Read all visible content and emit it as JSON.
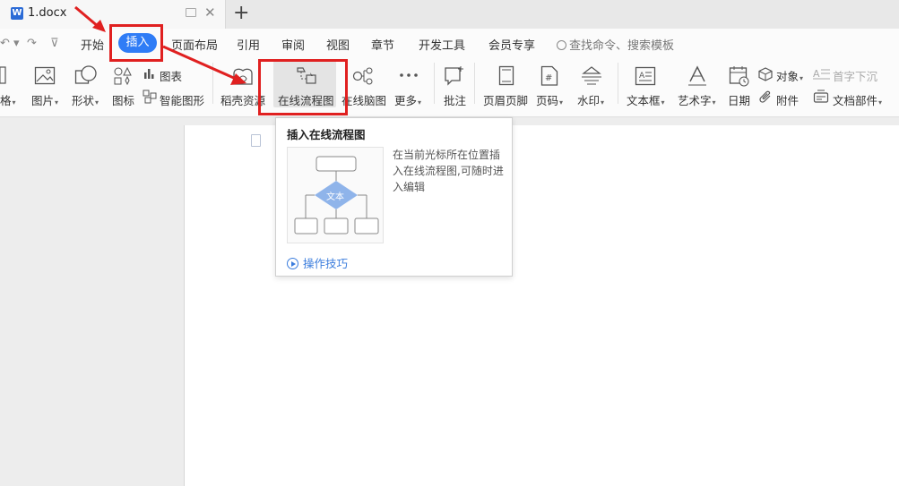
{
  "title_bar": {
    "doc_name": "1.docx",
    "logo_glyph": "W",
    "close_glyph": "✕",
    "new_tab_glyph": "+"
  },
  "menu": {
    "undo_glyph": "↶ ▾",
    "redo_glyph": "↷",
    "more_glyph": "⊽",
    "items": [
      {
        "label": "开始"
      },
      {
        "label": "插入",
        "active": true
      },
      {
        "label": "页面布局"
      },
      {
        "label": "引用"
      },
      {
        "label": "审阅"
      },
      {
        "label": "视图"
      },
      {
        "label": "章节"
      },
      {
        "label": "开发工具"
      },
      {
        "label": "会员专享"
      }
    ],
    "search_text": "查找命令、搜索模板"
  },
  "toolbar": {
    "partial_left": "格",
    "picture": "图片",
    "shape": "形状",
    "icon": "图标",
    "chart": "图表",
    "smart_shape": "智能图形",
    "docer_resources": "稻壳资源",
    "online_flowchart": "在线流程图",
    "online_mindmap": "在线脑图",
    "more": "更多",
    "comment": "批注",
    "header_footer": "页眉页脚",
    "page_number": "页码",
    "watermark": "水印",
    "text_box": "文本框",
    "word_art": "艺术字",
    "date": "日期",
    "object": "对象",
    "attachment": "附件",
    "drop_cap": "首字下沉",
    "doc_parts": "文档部件"
  },
  "tooltip": {
    "title": "插入在线流程图",
    "preview_node_label": "文本",
    "description": "在当前光标所在位置插入在线流程图,可随时进入编辑",
    "link": "操作技巧"
  },
  "colors": {
    "accent": "#2f7cf6",
    "annotation_red": "#e02020",
    "link_blue": "#3b7ddd",
    "flow_diamond": "#8fb4ea"
  }
}
